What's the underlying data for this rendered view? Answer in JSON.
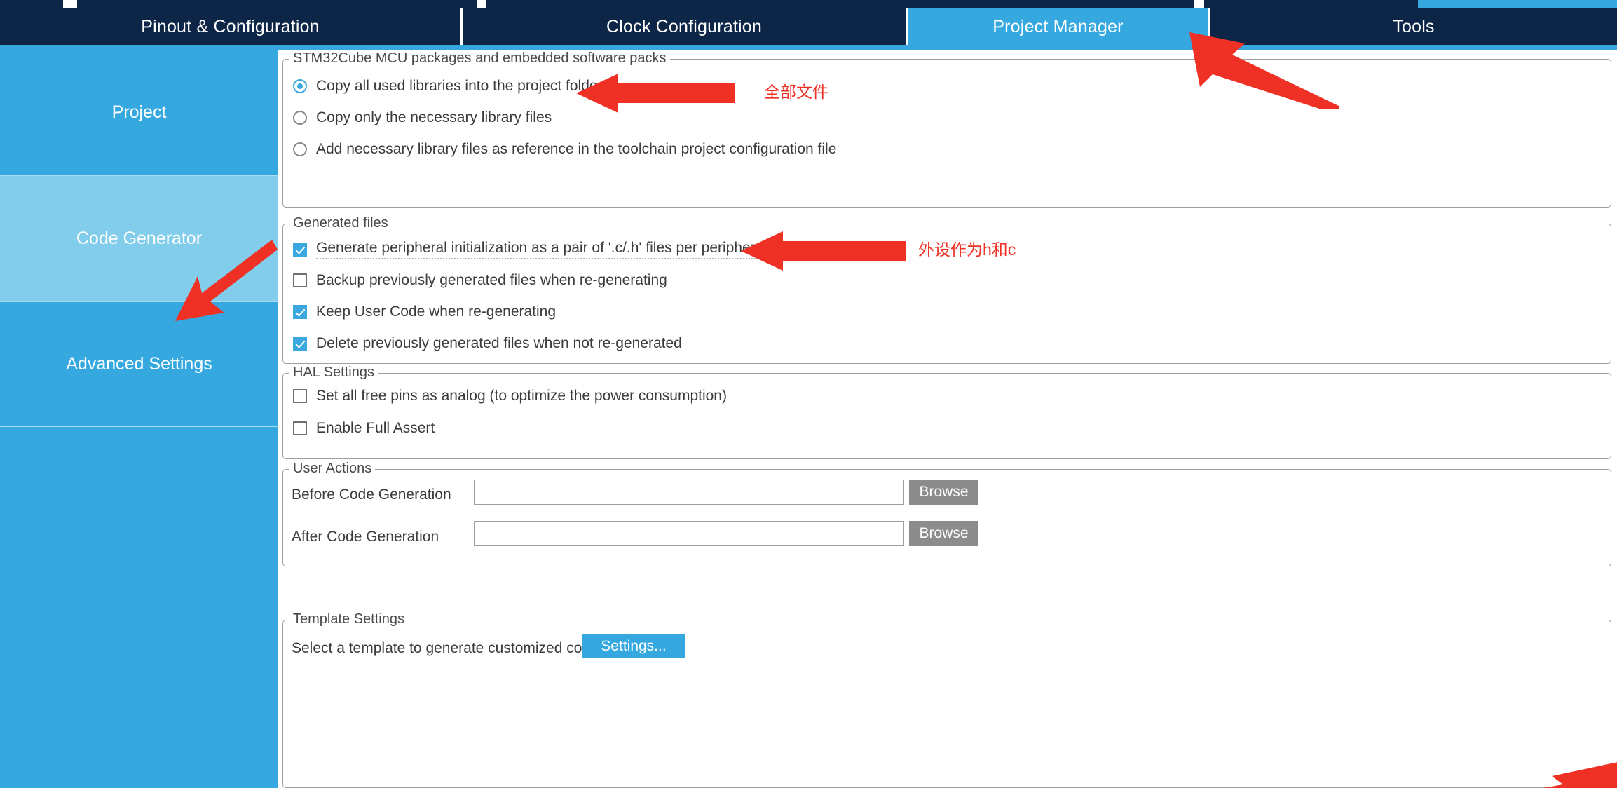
{
  "app": {
    "accent_blue": "#35a8e0",
    "tab_dark": "#0d2546",
    "active_sidebar_blue": "#81cdeb",
    "annotation_red": "#ee3124"
  },
  "tabs": [
    {
      "label": "Pinout & Configuration",
      "active": false
    },
    {
      "label": "Clock Configuration",
      "active": false
    },
    {
      "label": "Project Manager",
      "active": true
    },
    {
      "label": "Tools",
      "active": false
    }
  ],
  "sidebar": {
    "items": [
      {
        "label": "Project",
        "active": false
      },
      {
        "label": "Code Generator",
        "active": true
      },
      {
        "label": "Advanced Settings",
        "active": false
      }
    ]
  },
  "groups": {
    "packages": {
      "title": "STM32Cube MCU packages and embedded software packs",
      "options": [
        {
          "label": "Copy all used libraries into the project folder",
          "checked": true
        },
        {
          "label": "Copy only the necessary library files",
          "checked": false
        },
        {
          "label": "Add necessary library files as reference in the toolchain project configuration file",
          "checked": false
        }
      ]
    },
    "generated_files": {
      "title": "Generated files",
      "options": [
        {
          "label": "Generate peripheral initialization as a pair of '.c/.h' files per peripheral",
          "checked": true,
          "focused": true
        },
        {
          "label": "Backup previously generated files when re-generating",
          "checked": false,
          "focused": false
        },
        {
          "label": "Keep User Code when re-generating",
          "checked": true,
          "focused": false
        },
        {
          "label": "Delete previously generated files when not re-generated",
          "checked": true,
          "focused": false
        }
      ]
    },
    "hal_settings": {
      "title": "HAL Settings",
      "options": [
        {
          "label": "Set all free pins as analog (to optimize the power consumption)",
          "checked": false
        },
        {
          "label": "Enable Full Assert",
          "checked": false
        }
      ]
    },
    "user_actions": {
      "title": "User Actions",
      "rows": [
        {
          "label": "Before Code Generation",
          "value": "",
          "placeholder": "",
          "button": "Browse"
        },
        {
          "label": "After Code Generation",
          "value": "",
          "placeholder": "",
          "button": "Browse"
        }
      ]
    },
    "template_settings": {
      "title": "Template Settings",
      "label": "Select a template to generate customized code",
      "button": "Settings..."
    }
  },
  "annotations": [
    {
      "text": "全部文件"
    },
    {
      "text": "外设作为h和c"
    }
  ]
}
